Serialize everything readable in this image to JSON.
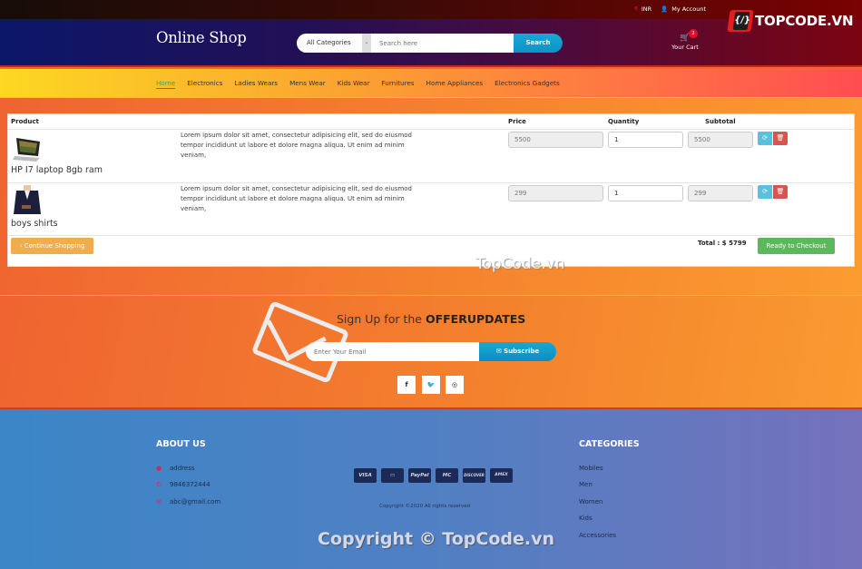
{
  "topbar": {
    "currency": {
      "icon": "rupee-icon",
      "label": "INR"
    },
    "account": {
      "icon": "user-icon",
      "label": "My Account"
    }
  },
  "header": {
    "logo": "Online Shop",
    "search": {
      "category_selected": "All Categories",
      "placeholder": "Search here",
      "button_label": "Search"
    },
    "cart": {
      "label": "Your Cart",
      "count": "2",
      "icon": "cart-icon"
    },
    "brand": {
      "mark": "{/}",
      "text": "TOPCODE.VN"
    }
  },
  "nav": {
    "items": [
      {
        "label": "Home",
        "active": true
      },
      {
        "label": "Electronics"
      },
      {
        "label": "Ladies Wears"
      },
      {
        "label": "Mens Wear"
      },
      {
        "label": "Kids Wear"
      },
      {
        "label": "Furnitures"
      },
      {
        "label": "Home Appliances"
      },
      {
        "label": "Electronics Gadgets"
      }
    ]
  },
  "cart_table": {
    "headers": {
      "product": "Product",
      "price": "Price",
      "quantity": "Quantity",
      "subtotal": "Subtotal"
    },
    "rows": [
      {
        "name": "HP I7 laptop 8gb ram",
        "image": "laptop-image",
        "description": "Lorem ipsum dolor sit amet, consectetur adipisicing elit, sed do eiusmod tempor incididunt ut labore et dolore magna aliqua. Ut enim ad minim veniam,",
        "price": "5500",
        "quantity": "1",
        "subtotal": "5500"
      },
      {
        "name": "boys shirts",
        "image": "shirt-image",
        "description": "Lorem ipsum dolor sit amet, consectetur adipisicing elit, sed do eiusmod tempor incididunt ut labore et dolore magna aliqua. Ut enim ad minim veniam,",
        "price": "299",
        "quantity": "1",
        "subtotal": "299"
      }
    ],
    "continue_label": "‹ Continue Shopping",
    "total_label": "Total : $ 5799",
    "checkout_label": "Ready to Checkout"
  },
  "watermarks": {
    "center": "TopCode.vn",
    "bottom": "Copyright © TopCode.vn"
  },
  "newsletter": {
    "title_prefix": "Sign Up for the ",
    "title_bold": "OFFERUPDATES",
    "placeholder": "Enter Your Email",
    "button_label": "✉ Subscribe",
    "social": [
      {
        "name": "facebook",
        "glyph": "f"
      },
      {
        "name": "twitter",
        "glyph": "t"
      },
      {
        "name": "instagram",
        "glyph": "◎"
      }
    ]
  },
  "footer": {
    "about": {
      "heading": "ABOUT US",
      "items": [
        {
          "icon": "map-pin-icon",
          "glyph": "●",
          "label": "address"
        },
        {
          "icon": "phone-icon",
          "glyph": "✆",
          "label": "9846372444"
        },
        {
          "icon": "envelope-icon",
          "glyph": "✉",
          "label": "abc@gmail.com"
        }
      ]
    },
    "payment_cards": [
      "VISA",
      "▭",
      "PayPal",
      "MC",
      "DISCOVER",
      "AMEX"
    ],
    "copyright": "Copyright ©2020 All rights reserved",
    "categories": {
      "heading": "CATEGORIES",
      "items": [
        "Mobiles",
        "Men",
        "Women",
        "Kids",
        "Accessories"
      ]
    }
  }
}
